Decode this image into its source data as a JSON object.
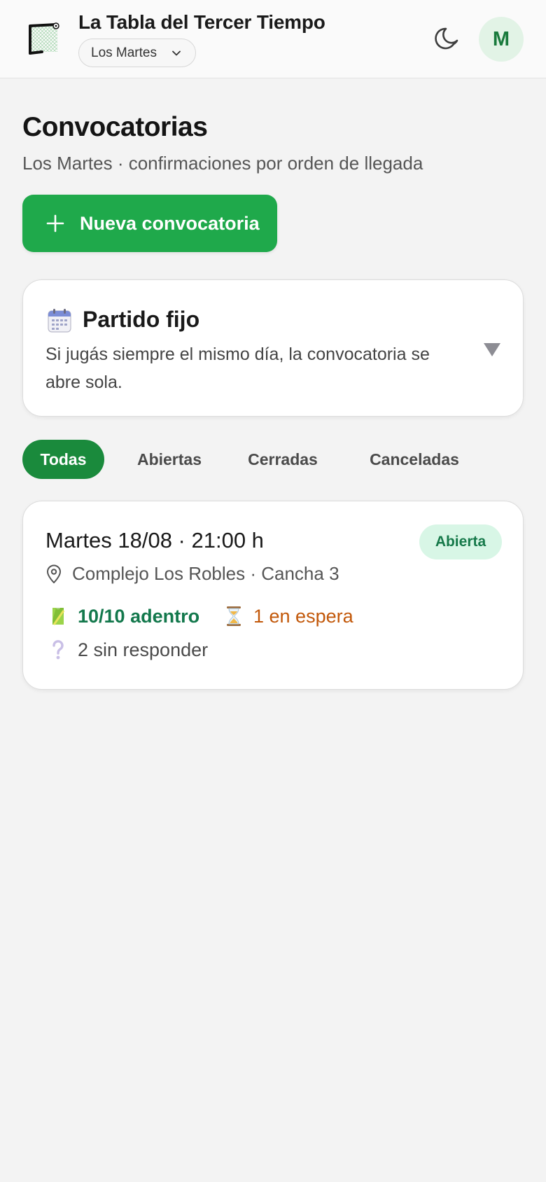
{
  "header": {
    "app_title": "La Tabla del Tercer Tiempo",
    "group_selector": "Los Martes",
    "avatar_initial": "M",
    "logo_icon": "goal-net-icon",
    "theme_icon": "moon-icon"
  },
  "page": {
    "title": "Convocatorias",
    "subtitle": "Los Martes · confirmaciones por orden de llegada",
    "new_button_label": "Nueva convocatoria"
  },
  "fixed_match": {
    "icon": "calendar-icon",
    "title": "Partido fijo",
    "description": "Si jugás siempre el mismo día, la convocatoria se abre sola."
  },
  "tabs": [
    {
      "label": "Todas",
      "active": true
    },
    {
      "label": "Abiertas",
      "active": false
    },
    {
      "label": "Cerradas",
      "active": false
    },
    {
      "label": "Canceladas",
      "active": false
    }
  ],
  "events": [
    {
      "title": "Martes 18/08 · 21:00 h",
      "status": "Abierta",
      "location": "Complejo Los Robles · Cancha 3",
      "confirmed": "10/10 adentro",
      "waiting": "1 en espera",
      "pending": "2 sin responder"
    }
  ],
  "colors": {
    "primary_green": "#1fa94b",
    "active_tab": "#1a8a3c",
    "confirmed_text": "#13784c",
    "waiting_text": "#c2580a",
    "badge_bg": "#d8f6e6",
    "badge_text": "#16794a"
  }
}
